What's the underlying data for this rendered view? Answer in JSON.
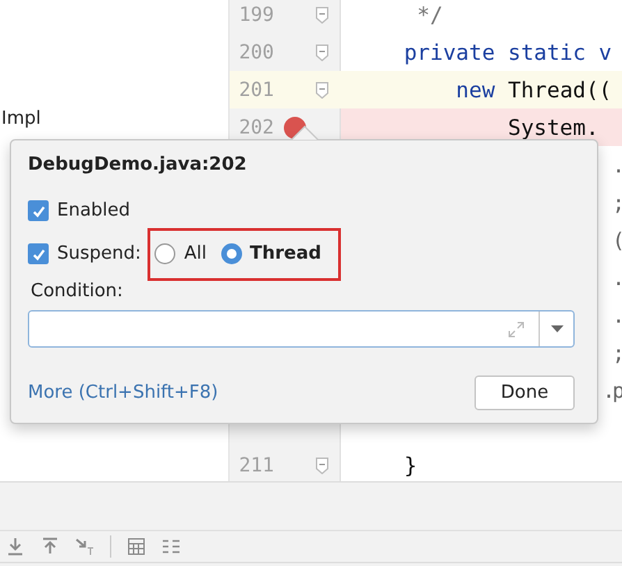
{
  "project_tree": {
    "item": "Impl"
  },
  "editor": {
    "lines_above": [
      {
        "number": "199",
        "current": false,
        "breakpoint": false,
        "fold": true,
        "tokens": [
          {
            "t": "     */",
            "kind": "comment"
          }
        ]
      },
      {
        "number": "200",
        "current": false,
        "breakpoint": false,
        "fold": true,
        "tokens": [
          {
            "t": "    private static v",
            "kind": "keyword"
          }
        ]
      },
      {
        "number": "201",
        "current": true,
        "breakpoint": false,
        "fold": true,
        "tokens": [
          {
            "t": "        new",
            "kind": "keyword"
          },
          {
            "t": " Thread((",
            "kind": "plain"
          }
        ]
      },
      {
        "number": "202",
        "current": false,
        "breakpoint": true,
        "fold": false,
        "tokens": [
          {
            "t": "            System.",
            "kind": "plain"
          }
        ]
      }
    ],
    "line_tails": [
      ".",
      ";",
      "(",
      ".",
      ".",
      ";",
      ".p"
    ],
    "lines_below": [
      {
        "number": "211",
        "current": false,
        "breakpoint": false,
        "fold": true,
        "tokens": [
          {
            "t": "    }",
            "kind": "plain"
          }
        ]
      }
    ]
  },
  "breakpoint_popup": {
    "title": "DebugDemo.java:202",
    "enabled": {
      "label": "Enabled",
      "checked": true
    },
    "suspend": {
      "label": "Suspend:",
      "checked": true
    },
    "suspend_options": [
      {
        "label": "All",
        "selected": false
      },
      {
        "label": "Thread",
        "selected": true
      }
    ],
    "condition": {
      "label": "Condition:"
    },
    "more_link": "More (Ctrl+Shift+F8)",
    "done_button": "Done"
  }
}
